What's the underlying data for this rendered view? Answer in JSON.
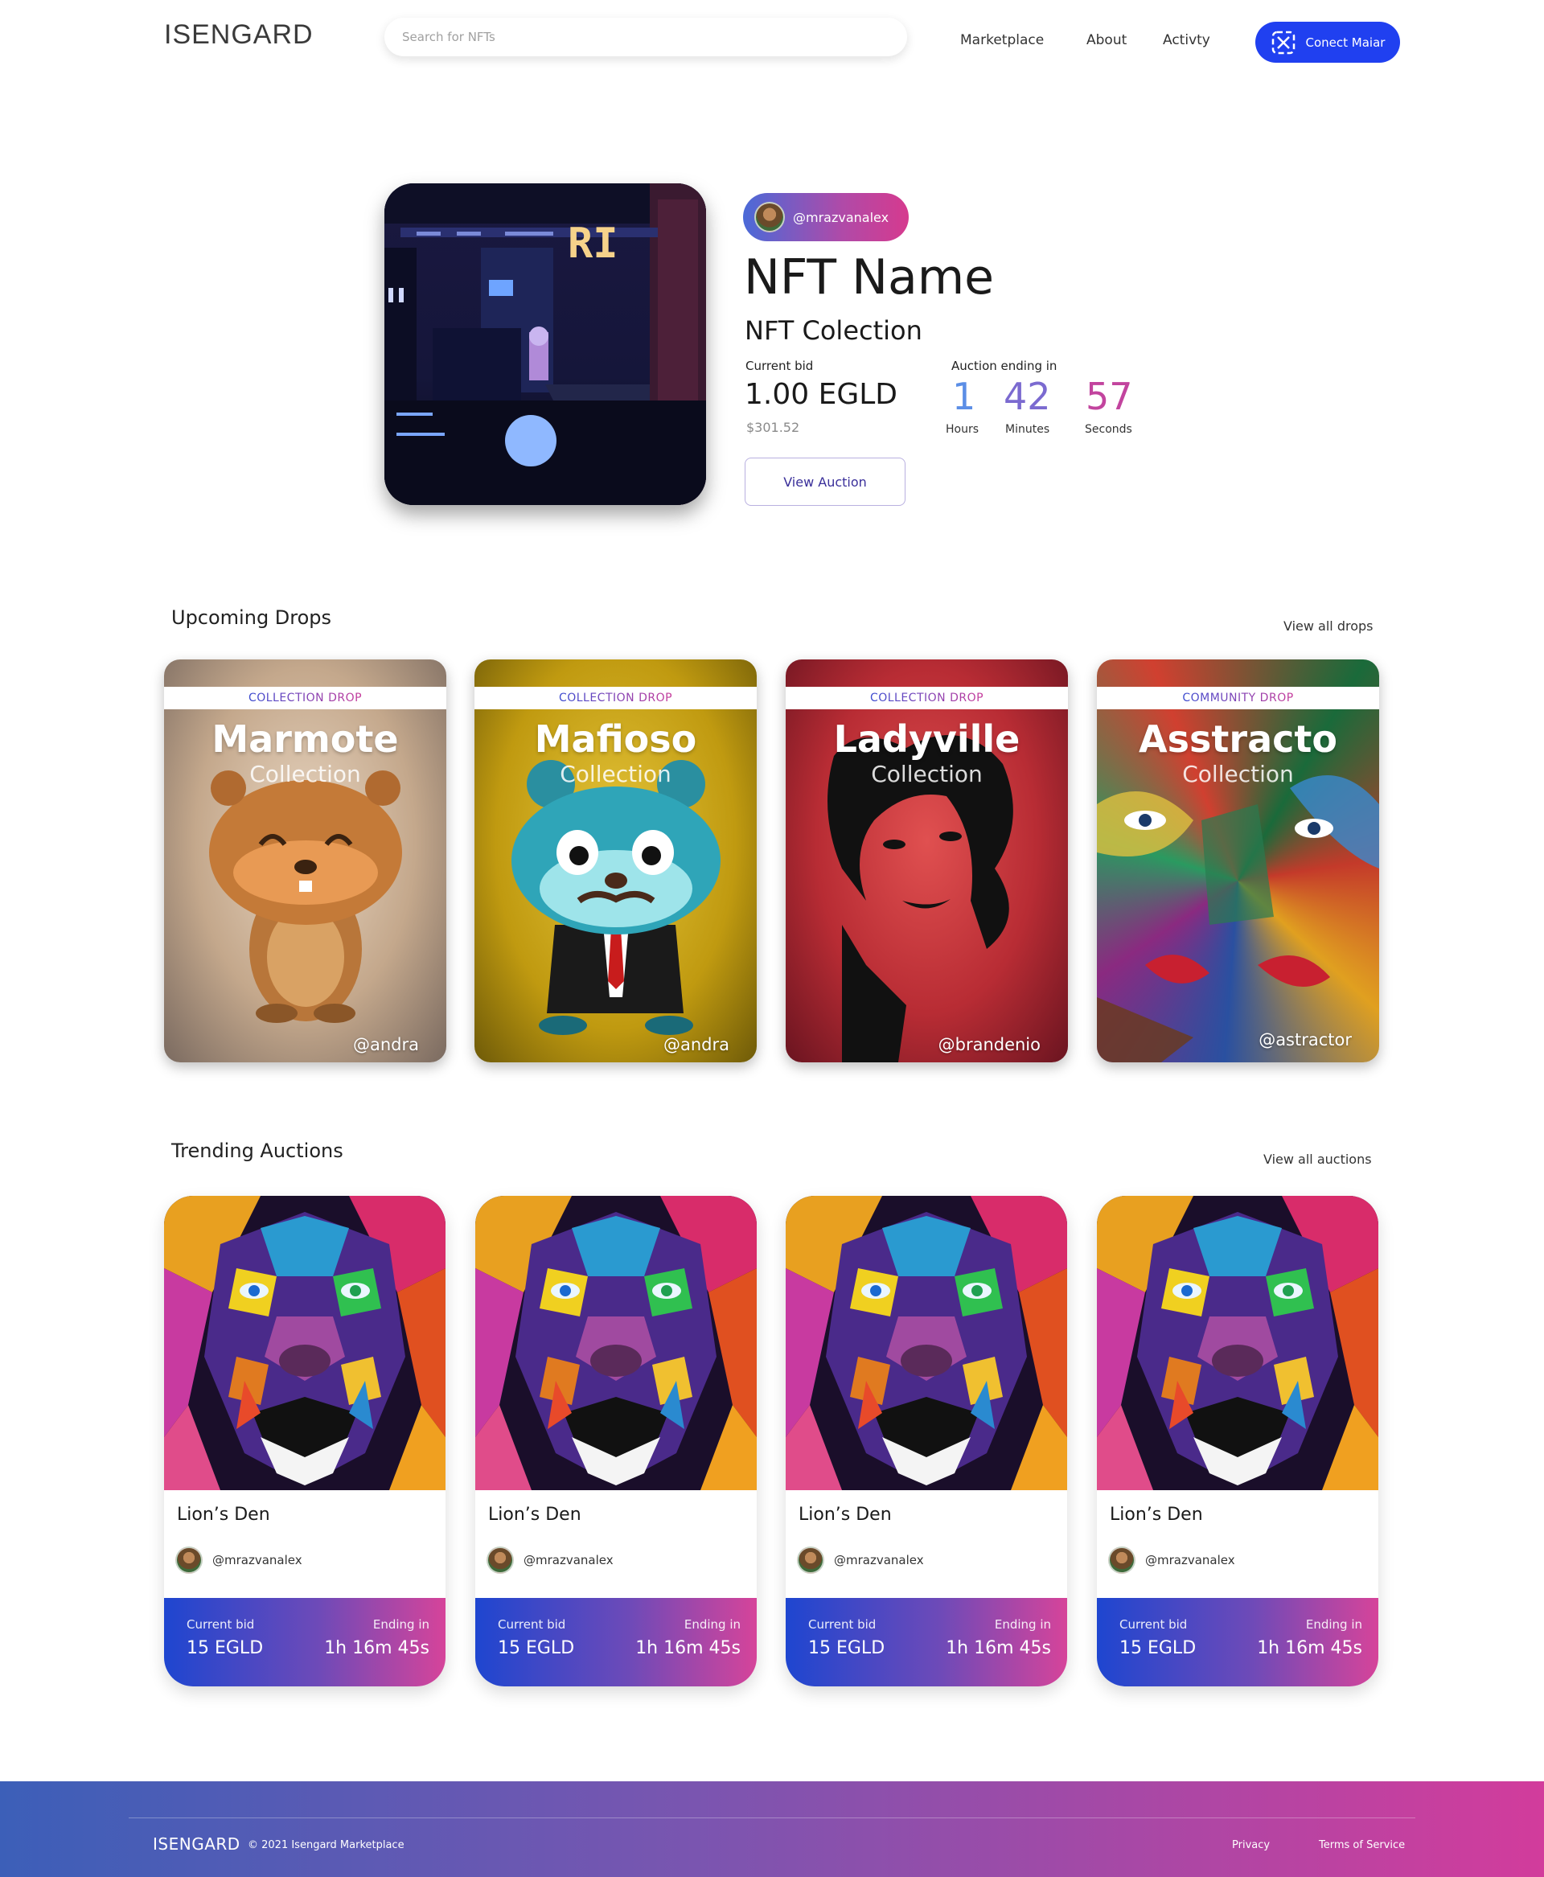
{
  "header": {
    "logo": "ISENGARD",
    "search_placeholder": "Search for NFTs",
    "nav": [
      "Marketplace",
      "About",
      "Activty"
    ],
    "connect_label": "Conect Maiar",
    "connect_icon": "maiar-icon",
    "accent_color": "#2040f0"
  },
  "hero": {
    "author": "@mrazvanalex",
    "name": "NFT Name",
    "collection": "NFT Colection",
    "current_bid_label": "Current bid",
    "current_bid": "1.00 EGLD",
    "current_bid_usd": "$301.52",
    "auction_label": "Auction ending in",
    "countdown": [
      {
        "value": "1",
        "unit": "Hours",
        "color": "#5b8ee6"
      },
      {
        "value": "42",
        "unit": "Minutes",
        "color": "#7b6ad0"
      },
      {
        "value": "57",
        "unit": "Seconds",
        "color": "#c2449e"
      }
    ],
    "view_button": "View Auction"
  },
  "drops": {
    "title": "Upcoming Drops",
    "view_all": "View all drops",
    "items": [
      {
        "tag": "COLLECTION DROP",
        "name": "Marmote",
        "sub": "Collection",
        "author": "@andra"
      },
      {
        "tag": "COLLECTION DROP",
        "name": "Mafioso",
        "sub": "Collection",
        "author": "@andra"
      },
      {
        "tag": "COLLECTION DROP",
        "name": "Ladyville",
        "sub": "Collection",
        "author": "@brandenio"
      },
      {
        "tag": "COMMUNITY DROP",
        "name": "Asstracto",
        "sub": "Collection",
        "author": "@astractor"
      }
    ]
  },
  "auctions": {
    "title": "Trending Auctions",
    "view_all": "View all auctions",
    "items": [
      {
        "name": "Lion’s Den",
        "author": "@mrazvanalex",
        "bid_label": "Current bid",
        "bid": "15 EGLD",
        "ending_label": "Ending in",
        "ending": "1h 16m 45s"
      },
      {
        "name": "Lion’s Den",
        "author": "@mrazvanalex",
        "bid_label": "Current bid",
        "bid": "15 EGLD",
        "ending_label": "Ending in",
        "ending": "1h 16m 45s"
      },
      {
        "name": "Lion’s Den",
        "author": "@mrazvanalex",
        "bid_label": "Current bid",
        "bid": "15 EGLD",
        "ending_label": "Ending in",
        "ending": "1h 16m 45s"
      },
      {
        "name": "Lion’s Den",
        "author": "@mrazvanalex",
        "bid_label": "Current bid",
        "bid": "15 EGLD",
        "ending_label": "Ending in",
        "ending": "1h 16m 45s"
      }
    ]
  },
  "footer": {
    "logo": "ISENGARD",
    "copyright": "© 2021 Isengard Marketplace",
    "links": [
      "Privacy",
      "Terms of Service"
    ]
  }
}
